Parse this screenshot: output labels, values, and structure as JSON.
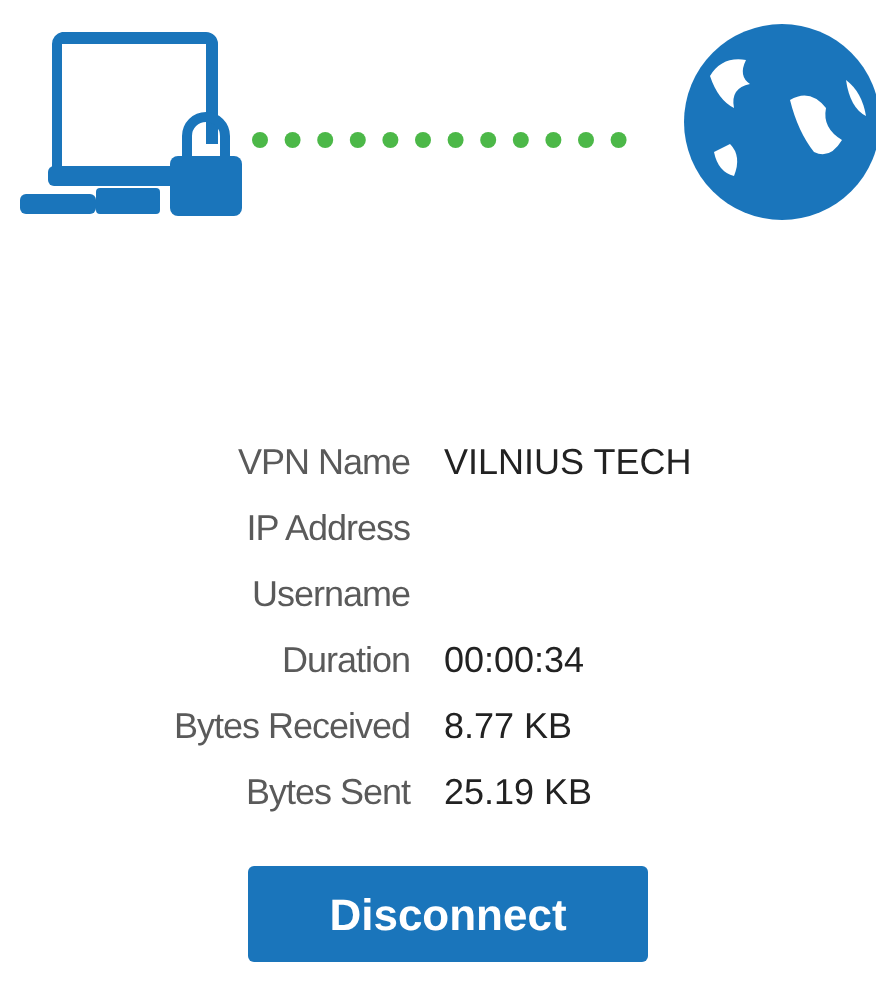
{
  "details": [
    {
      "label": "VPN Name",
      "value": "VILNIUS TECH"
    },
    {
      "label": "IP Address"
    },
    {
      "label": "Username"
    },
    {
      "label": "Duration",
      "value": "00:00:34"
    },
    {
      "label": "Bytes Received",
      "value": "8.77 KB"
    },
    {
      "label": "Bytes Sent",
      "value": "25.19 KB"
    }
  ],
  "button": {
    "label": "Disconnect"
  }
}
